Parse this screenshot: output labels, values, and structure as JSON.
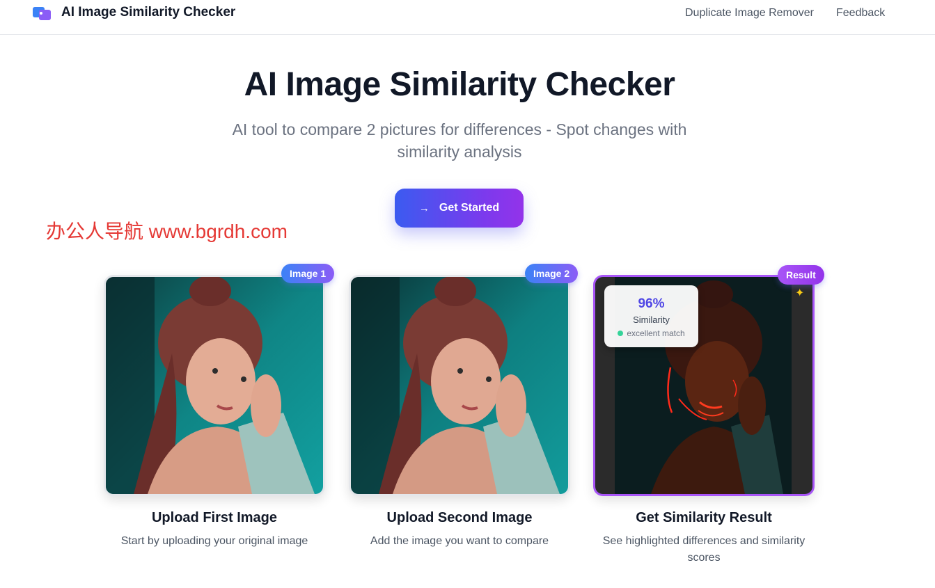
{
  "header": {
    "brand": "AI Image Similarity Checker",
    "nav": [
      "Duplicate Image Remover",
      "Feedback"
    ]
  },
  "hero": {
    "title": "AI Image Similarity Checker",
    "subtitle": "AI tool to compare 2 pictures for differences - Spot changes with similarity analysis",
    "cta_label": "Get Started",
    "cta_icon": "arrow-right-icon"
  },
  "watermark": "办公人导航  www.bgrdh.com",
  "steps": [
    {
      "badge": "Image 1",
      "title": "Upload First Image",
      "description": "Start by uploading your original image"
    },
    {
      "badge": "Image 2",
      "title": "Upload Second Image",
      "description": "Add the image you want to compare"
    },
    {
      "badge": "Result",
      "title": "Get Similarity Result",
      "description": "See highlighted differences and similarity scores"
    }
  ],
  "result": {
    "similarity_value": "96%",
    "similarity_label": "Similarity",
    "match_label": "excellent match",
    "sparkle_icon": "sparkle-icon"
  },
  "colors": {
    "accent_blue": "#3b5bf0",
    "accent_purple": "#9333ea",
    "similarity_text": "#4f46e5",
    "match_dot": "#34d399"
  }
}
